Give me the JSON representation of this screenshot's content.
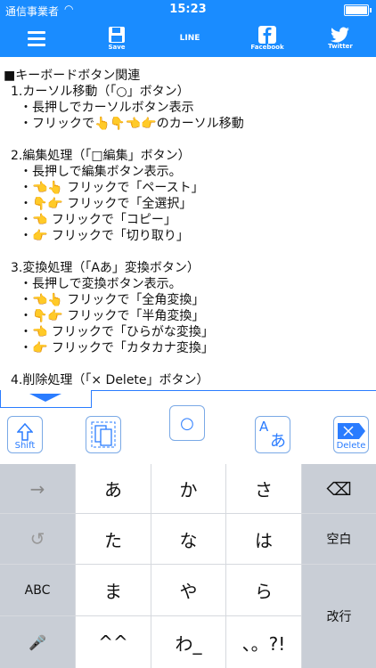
{
  "status_bar": {
    "carrier": "通信事業者",
    "time": "15:23"
  },
  "toolbar": {
    "save_label": "Save",
    "line_label": "LINE",
    "facebook_label": "Facebook",
    "twitter_label": "Twitter"
  },
  "content": {
    "lines": [
      "■キーボードボタン関連",
      "1.カーソル移動（「○」ボタン）",
      "・長押しでカーソルボタン表示",
      "・フリックで👆👇👈👉のカーソル移動",
      "",
      "2.編集処理（「□編集」ボタン）",
      "・長押しで編集ボタン表示。",
      "・👈👆 フリックで「ペースト」",
      "・👇👉 フリックで「全選択」",
      "・👈 フリックで「コピー」",
      "・👉 フリックで「切り取り」",
      "",
      "3.変換処理（「Aあ」変換ボタン）",
      "・長押しで変換ボタン表示。",
      "・👈👆 フリックで「全角変換」",
      "・👇👉 フリックで「半角変換」",
      "・👈 フリックで「ひらがな変換」",
      "・👉 フリックで「カタカナ変換」",
      "",
      "4.削除処理（「× Delete」ボタン）"
    ]
  },
  "kb_toolbar": {
    "shift_label": "Shift",
    "cursor_symbol": "○",
    "delete_label": "Delete",
    "convert_a": "A",
    "convert_kana": "あ"
  },
  "keyboard": {
    "row1": [
      "→",
      "あ",
      "か",
      "さ",
      "⌫"
    ],
    "row2": [
      "↺",
      "た",
      "な",
      "は",
      "空白"
    ],
    "row3": [
      "ABC",
      "ま",
      "や",
      "ら",
      "改行"
    ],
    "row4": [
      "🎤",
      "^^",
      "わ_",
      "、。?!"
    ]
  }
}
